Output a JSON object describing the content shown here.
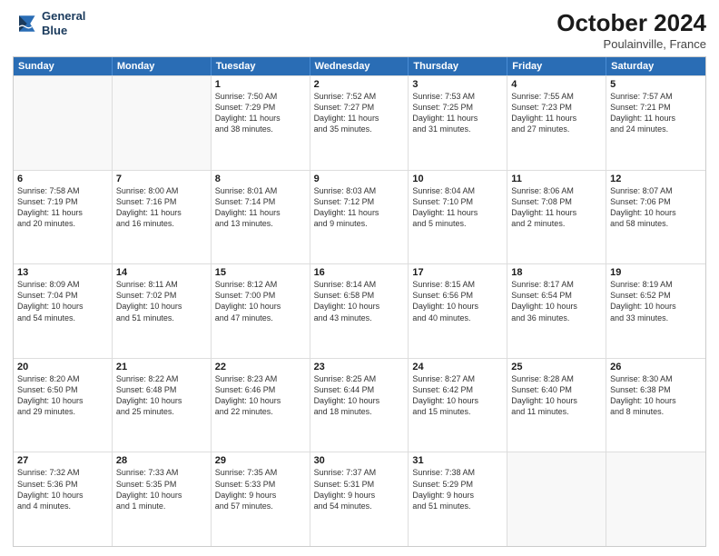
{
  "logo": {
    "line1": "General",
    "line2": "Blue"
  },
  "title": "October 2024",
  "subtitle": "Poulainville, France",
  "header_days": [
    "Sunday",
    "Monday",
    "Tuesday",
    "Wednesday",
    "Thursday",
    "Friday",
    "Saturday"
  ],
  "rows": [
    [
      {
        "day": "",
        "lines": []
      },
      {
        "day": "",
        "lines": []
      },
      {
        "day": "1",
        "lines": [
          "Sunrise: 7:50 AM",
          "Sunset: 7:29 PM",
          "Daylight: 11 hours",
          "and 38 minutes."
        ]
      },
      {
        "day": "2",
        "lines": [
          "Sunrise: 7:52 AM",
          "Sunset: 7:27 PM",
          "Daylight: 11 hours",
          "and 35 minutes."
        ]
      },
      {
        "day": "3",
        "lines": [
          "Sunrise: 7:53 AM",
          "Sunset: 7:25 PM",
          "Daylight: 11 hours",
          "and 31 minutes."
        ]
      },
      {
        "day": "4",
        "lines": [
          "Sunrise: 7:55 AM",
          "Sunset: 7:23 PM",
          "Daylight: 11 hours",
          "and 27 minutes."
        ]
      },
      {
        "day": "5",
        "lines": [
          "Sunrise: 7:57 AM",
          "Sunset: 7:21 PM",
          "Daylight: 11 hours",
          "and 24 minutes."
        ]
      }
    ],
    [
      {
        "day": "6",
        "lines": [
          "Sunrise: 7:58 AM",
          "Sunset: 7:19 PM",
          "Daylight: 11 hours",
          "and 20 minutes."
        ]
      },
      {
        "day": "7",
        "lines": [
          "Sunrise: 8:00 AM",
          "Sunset: 7:16 PM",
          "Daylight: 11 hours",
          "and 16 minutes."
        ]
      },
      {
        "day": "8",
        "lines": [
          "Sunrise: 8:01 AM",
          "Sunset: 7:14 PM",
          "Daylight: 11 hours",
          "and 13 minutes."
        ]
      },
      {
        "day": "9",
        "lines": [
          "Sunrise: 8:03 AM",
          "Sunset: 7:12 PM",
          "Daylight: 11 hours",
          "and 9 minutes."
        ]
      },
      {
        "day": "10",
        "lines": [
          "Sunrise: 8:04 AM",
          "Sunset: 7:10 PM",
          "Daylight: 11 hours",
          "and 5 minutes."
        ]
      },
      {
        "day": "11",
        "lines": [
          "Sunrise: 8:06 AM",
          "Sunset: 7:08 PM",
          "Daylight: 11 hours",
          "and 2 minutes."
        ]
      },
      {
        "day": "12",
        "lines": [
          "Sunrise: 8:07 AM",
          "Sunset: 7:06 PM",
          "Daylight: 10 hours",
          "and 58 minutes."
        ]
      }
    ],
    [
      {
        "day": "13",
        "lines": [
          "Sunrise: 8:09 AM",
          "Sunset: 7:04 PM",
          "Daylight: 10 hours",
          "and 54 minutes."
        ]
      },
      {
        "day": "14",
        "lines": [
          "Sunrise: 8:11 AM",
          "Sunset: 7:02 PM",
          "Daylight: 10 hours",
          "and 51 minutes."
        ]
      },
      {
        "day": "15",
        "lines": [
          "Sunrise: 8:12 AM",
          "Sunset: 7:00 PM",
          "Daylight: 10 hours",
          "and 47 minutes."
        ]
      },
      {
        "day": "16",
        "lines": [
          "Sunrise: 8:14 AM",
          "Sunset: 6:58 PM",
          "Daylight: 10 hours",
          "and 43 minutes."
        ]
      },
      {
        "day": "17",
        "lines": [
          "Sunrise: 8:15 AM",
          "Sunset: 6:56 PM",
          "Daylight: 10 hours",
          "and 40 minutes."
        ]
      },
      {
        "day": "18",
        "lines": [
          "Sunrise: 8:17 AM",
          "Sunset: 6:54 PM",
          "Daylight: 10 hours",
          "and 36 minutes."
        ]
      },
      {
        "day": "19",
        "lines": [
          "Sunrise: 8:19 AM",
          "Sunset: 6:52 PM",
          "Daylight: 10 hours",
          "and 33 minutes."
        ]
      }
    ],
    [
      {
        "day": "20",
        "lines": [
          "Sunrise: 8:20 AM",
          "Sunset: 6:50 PM",
          "Daylight: 10 hours",
          "and 29 minutes."
        ]
      },
      {
        "day": "21",
        "lines": [
          "Sunrise: 8:22 AM",
          "Sunset: 6:48 PM",
          "Daylight: 10 hours",
          "and 25 minutes."
        ]
      },
      {
        "day": "22",
        "lines": [
          "Sunrise: 8:23 AM",
          "Sunset: 6:46 PM",
          "Daylight: 10 hours",
          "and 22 minutes."
        ]
      },
      {
        "day": "23",
        "lines": [
          "Sunrise: 8:25 AM",
          "Sunset: 6:44 PM",
          "Daylight: 10 hours",
          "and 18 minutes."
        ]
      },
      {
        "day": "24",
        "lines": [
          "Sunrise: 8:27 AM",
          "Sunset: 6:42 PM",
          "Daylight: 10 hours",
          "and 15 minutes."
        ]
      },
      {
        "day": "25",
        "lines": [
          "Sunrise: 8:28 AM",
          "Sunset: 6:40 PM",
          "Daylight: 10 hours",
          "and 11 minutes."
        ]
      },
      {
        "day": "26",
        "lines": [
          "Sunrise: 8:30 AM",
          "Sunset: 6:38 PM",
          "Daylight: 10 hours",
          "and 8 minutes."
        ]
      }
    ],
    [
      {
        "day": "27",
        "lines": [
          "Sunrise: 7:32 AM",
          "Sunset: 5:36 PM",
          "Daylight: 10 hours",
          "and 4 minutes."
        ]
      },
      {
        "day": "28",
        "lines": [
          "Sunrise: 7:33 AM",
          "Sunset: 5:35 PM",
          "Daylight: 10 hours",
          "and 1 minute."
        ]
      },
      {
        "day": "29",
        "lines": [
          "Sunrise: 7:35 AM",
          "Sunset: 5:33 PM",
          "Daylight: 9 hours",
          "and 57 minutes."
        ]
      },
      {
        "day": "30",
        "lines": [
          "Sunrise: 7:37 AM",
          "Sunset: 5:31 PM",
          "Daylight: 9 hours",
          "and 54 minutes."
        ]
      },
      {
        "day": "31",
        "lines": [
          "Sunrise: 7:38 AM",
          "Sunset: 5:29 PM",
          "Daylight: 9 hours",
          "and 51 minutes."
        ]
      },
      {
        "day": "",
        "lines": []
      },
      {
        "day": "",
        "lines": []
      }
    ]
  ]
}
